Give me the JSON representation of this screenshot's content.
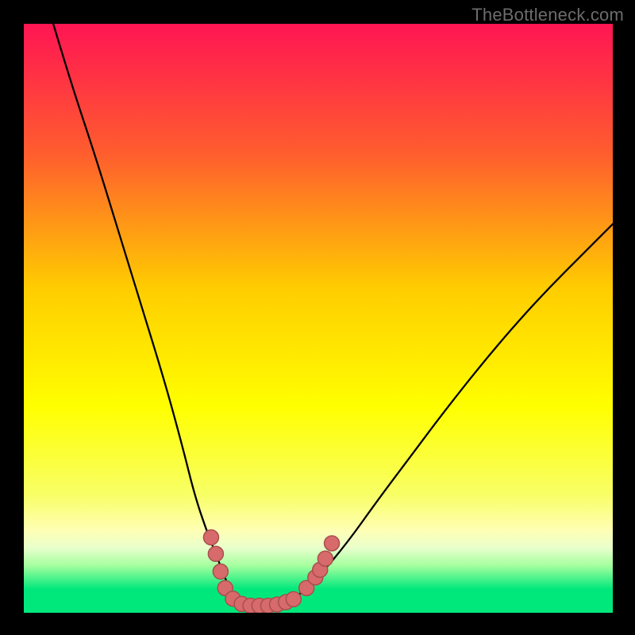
{
  "watermark": "TheBottleneck.com",
  "chart_data": {
    "type": "line",
    "title": "",
    "xlabel": "",
    "ylabel": "",
    "xlim": [
      0,
      100
    ],
    "ylim": [
      0,
      100
    ],
    "grid": false,
    "legend": false,
    "gradient_bands": [
      {
        "y": 100,
        "color": "#ff1553"
      },
      {
        "y": 78,
        "color": "#ff5d2e"
      },
      {
        "y": 55,
        "color": "#ffcd00"
      },
      {
        "y": 35,
        "color": "#ffff00"
      },
      {
        "y": 20,
        "color": "#f8ff66"
      },
      {
        "y": 14,
        "color": "#ffffb4"
      },
      {
        "y": 11,
        "color": "#e8ffcc"
      },
      {
        "y": 8,
        "color": "#a4ff9e"
      },
      {
        "y": 4,
        "color": "#00e87c"
      },
      {
        "y": 0,
        "color": "#00e87c"
      }
    ],
    "series": [
      {
        "name": "bottleneck-curve",
        "x": [
          5,
          8,
          12,
          16,
          20,
          24,
          27,
          29,
          31,
          33,
          34.5,
          36,
          38,
          40,
          42,
          44,
          46,
          50,
          55,
          60,
          66,
          72,
          80,
          88,
          96,
          100
        ],
        "y": [
          100,
          90,
          78,
          65,
          52,
          39,
          28,
          20,
          14,
          9,
          5,
          2.2,
          1.3,
          1.1,
          1.1,
          1.3,
          2.4,
          6,
          12,
          19,
          27,
          35,
          45,
          54,
          62,
          66
        ]
      }
    ],
    "scatter": [
      {
        "name": "near-bottom-dots",
        "color": "#d76a6a",
        "border": "#a84f4f",
        "points": [
          {
            "x": 31.8,
            "y": 12.8
          },
          {
            "x": 32.6,
            "y": 10.0
          },
          {
            "x": 33.4,
            "y": 7.0
          },
          {
            "x": 34.2,
            "y": 4.2
          },
          {
            "x": 35.5,
            "y": 2.4
          },
          {
            "x": 37.0,
            "y": 1.5
          },
          {
            "x": 38.5,
            "y": 1.2
          },
          {
            "x": 40.0,
            "y": 1.2
          },
          {
            "x": 41.5,
            "y": 1.2
          },
          {
            "x": 43.0,
            "y": 1.4
          },
          {
            "x": 44.5,
            "y": 1.8
          },
          {
            "x": 45.8,
            "y": 2.3
          },
          {
            "x": 48.0,
            "y": 4.2
          },
          {
            "x": 49.5,
            "y": 6.0
          },
          {
            "x": 50.3,
            "y": 7.3
          },
          {
            "x": 51.2,
            "y": 9.2
          },
          {
            "x": 52.3,
            "y": 11.8
          }
        ]
      }
    ]
  }
}
